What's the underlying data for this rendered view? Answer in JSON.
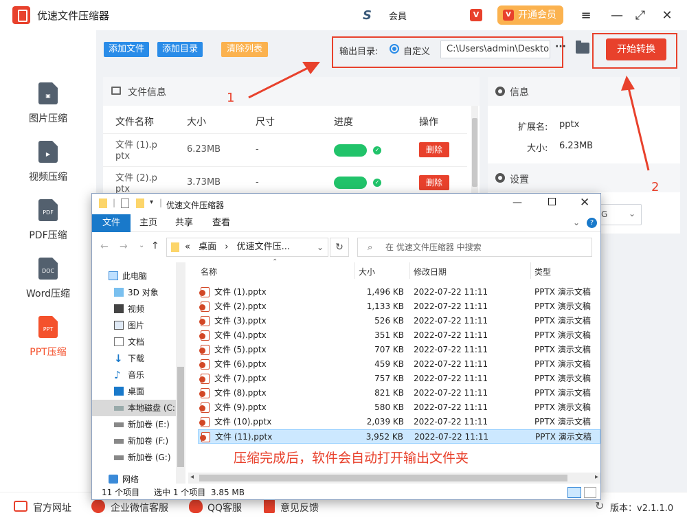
{
  "app": {
    "title": "优速文件压缩器",
    "user_name": "会員",
    "vip_label": "开通会员",
    "vip_badge": "V"
  },
  "window_controls": [
    "≡",
    "—",
    "⤢",
    "✕"
  ],
  "sidebar": [
    {
      "label": "图片压缩",
      "icon": "image-file-icon",
      "glyph": "▣"
    },
    {
      "label": "视频压缩",
      "icon": "video-file-icon",
      "glyph": "▶"
    },
    {
      "label": "PDF压缩",
      "icon": "pdf-file-icon",
      "glyph": "PDF"
    },
    {
      "label": "Word压缩",
      "icon": "doc-file-icon",
      "glyph": "DOC"
    },
    {
      "label": "PPT压缩",
      "icon": "ppt-file-icon",
      "glyph": "PPT",
      "active": true
    }
  ],
  "toolbar": {
    "add_file": "添加文件",
    "add_dir": "添加目录",
    "clear_list": "清除列表",
    "output_label": "输出目录:",
    "custom_label": "自定义",
    "output_path": "C:\\Users\\admin\\Desktop",
    "more": "···",
    "start": "开始转换"
  },
  "file_panel": {
    "title": "文件信息",
    "headers": [
      "文件名称",
      "大小",
      "尺寸",
      "进度",
      "操作"
    ],
    "rows": [
      {
        "name1": "文件 (1).p",
        "name2": "ptx",
        "size": "6.23MB",
        "dim": "-",
        "action": "删除"
      },
      {
        "name1": "文件 (2).p",
        "name2": "ptx",
        "size": "3.73MB",
        "dim": "-",
        "action": "删除"
      }
    ]
  },
  "info_panel": {
    "title": "信息",
    "ext_label": "扩展名:",
    "ext_value": "pptx",
    "size_label": "大小:",
    "size_value": "6.23MB",
    "settings_title": "设置",
    "select_value": "G"
  },
  "annotations": {
    "one": "1",
    "two": "2",
    "note": "压缩完成后，软件会自动打开输出文件夹"
  },
  "bottom": {
    "website": "官方网址",
    "wechat": "企业微信客服",
    "qq": "QQ客服",
    "feedback": "意见反馈",
    "version": "版本：v2.1.1.0"
  },
  "explorer": {
    "title": "优速文件压缩器",
    "tabs": [
      "文件",
      "主页",
      "共享",
      "查看"
    ],
    "address": [
      "«",
      "桌面",
      "›",
      "优速文件压..."
    ],
    "search_placeholder": "在 优速文件压缩器 中搜索",
    "nav": [
      {
        "label": "此电脑",
        "icon": "computer-icon"
      },
      {
        "label": "3D 对象",
        "icon": "3d-objects-icon"
      },
      {
        "label": "视频",
        "icon": "videos-folder-icon"
      },
      {
        "label": "图片",
        "icon": "pictures-folder-icon"
      },
      {
        "label": "文档",
        "icon": "documents-folder-icon"
      },
      {
        "label": "下载",
        "icon": "downloads-folder-icon"
      },
      {
        "label": "音乐",
        "icon": "music-folder-icon"
      },
      {
        "label": "桌面",
        "icon": "desktop-folder-icon"
      },
      {
        "label": "本地磁盘 (C:",
        "icon": "drive-c-icon"
      },
      {
        "label": "新加卷 (E:)",
        "icon": "drive-e-icon"
      },
      {
        "label": "新加卷 (F:)",
        "icon": "drive-f-icon"
      },
      {
        "label": "新加卷 (G:)",
        "icon": "drive-g-icon"
      },
      {
        "label": "网络",
        "icon": "network-icon"
      }
    ],
    "columns": [
      "名称",
      "大小",
      "修改日期",
      "类型"
    ],
    "files": [
      {
        "name": "文件 (1).pptx",
        "size": "1,496 KB",
        "date": "2022-07-22 11:11",
        "type": "PPTX 演示文稿"
      },
      {
        "name": "文件 (2).pptx",
        "size": "1,133 KB",
        "date": "2022-07-22 11:11",
        "type": "PPTX 演示文稿"
      },
      {
        "name": "文件 (3).pptx",
        "size": "526 KB",
        "date": "2022-07-22 11:11",
        "type": "PPTX 演示文稿"
      },
      {
        "name": "文件 (4).pptx",
        "size": "351 KB",
        "date": "2022-07-22 11:11",
        "type": "PPTX 演示文稿"
      },
      {
        "name": "文件 (5).pptx",
        "size": "707 KB",
        "date": "2022-07-22 11:11",
        "type": "PPTX 演示文稿"
      },
      {
        "name": "文件 (6).pptx",
        "size": "459 KB",
        "date": "2022-07-22 11:11",
        "type": "PPTX 演示文稿"
      },
      {
        "name": "文件 (7).pptx",
        "size": "757 KB",
        "date": "2022-07-22 11:11",
        "type": "PPTX 演示文稿"
      },
      {
        "name": "文件 (8).pptx",
        "size": "821 KB",
        "date": "2022-07-22 11:11",
        "type": "PPTX 演示文稿"
      },
      {
        "name": "文件 (9).pptx",
        "size": "580 KB",
        "date": "2022-07-22 11:11",
        "type": "PPTX 演示文稿"
      },
      {
        "name": "文件 (10).pptx",
        "size": "2,039 KB",
        "date": "2022-07-22 11:11",
        "type": "PPTX 演示文稿"
      },
      {
        "name": "文件 (11).pptx",
        "size": "3,952 KB",
        "date": "2022-07-22 11:11",
        "type": "PPTX 演示文稿",
        "selected": true
      }
    ],
    "status_count": "11 个项目",
    "status_selected": "选中 1 个项目  3.85 MB"
  },
  "colors": {
    "accent_red": "#e8412c",
    "blue": "#2a8ce8",
    "orange": "#fbb24f",
    "green": "#21c36a",
    "explorer_blue": "#1979ca"
  }
}
